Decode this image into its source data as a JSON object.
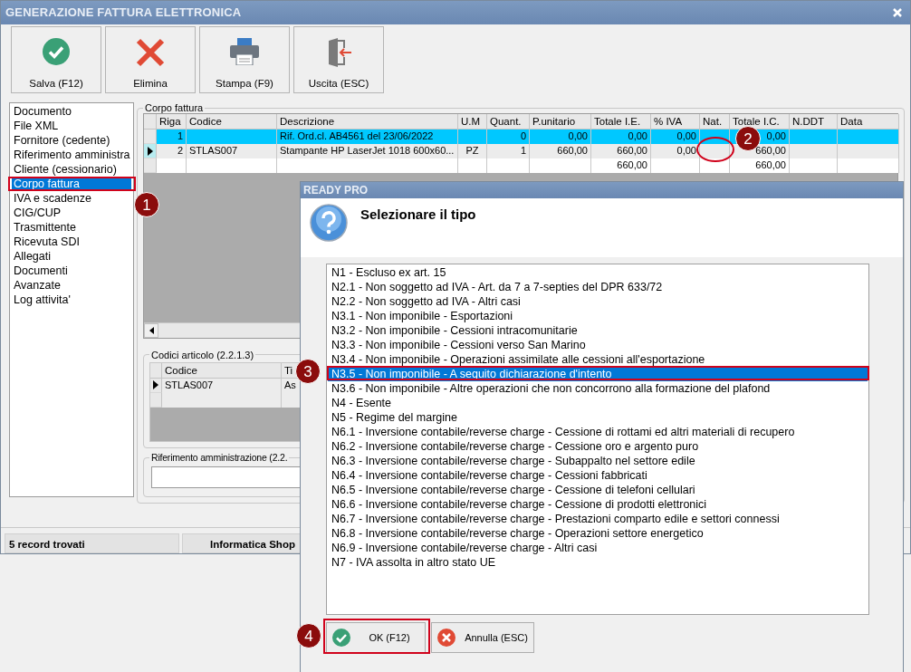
{
  "window": {
    "title": "GENERAZIONE FATTURA ELETTRONICA"
  },
  "toolbar": [
    {
      "label": "Salva (F12)",
      "kind": "save"
    },
    {
      "label": "Elimina",
      "kind": "delete"
    },
    {
      "label": "Stampa (F9)",
      "kind": "print"
    },
    {
      "label": "Uscita (ESC)",
      "kind": "exit"
    }
  ],
  "nav": {
    "items": [
      {
        "label": "Documento",
        "selected": false
      },
      {
        "label": "File XML",
        "selected": false
      },
      {
        "label": "Fornitore (cedente)",
        "selected": false
      },
      {
        "label": "Riferimento amministra",
        "selected": false
      },
      {
        "label": "Cliente (cessionario)",
        "selected": false
      },
      {
        "label": "Corpo fattura",
        "selected": true
      },
      {
        "label": "IVA e scadenze",
        "selected": false
      },
      {
        "label": "CIG/CUP",
        "selected": false
      },
      {
        "label": "Trasmittente",
        "selected": false
      },
      {
        "label": "Ricevuta SDI",
        "selected": false
      },
      {
        "label": "Allegati",
        "selected": false
      },
      {
        "label": "Documenti",
        "selected": false
      },
      {
        "label": "Avanzate",
        "selected": false
      },
      {
        "label": "Log attivita'",
        "selected": false
      }
    ]
  },
  "invoice_body": {
    "title": "Corpo fattura",
    "columns": [
      "Riga",
      "Codice",
      "Descrizione",
      "U.M",
      "Quant.",
      "P.unitario",
      "Totale I.E.",
      "% IVA",
      "Nat.",
      "Totale I.C.",
      "N.DDT",
      "Data"
    ],
    "rows": [
      {
        "selected": true,
        "current": false,
        "cells": [
          "1",
          null,
          "Rif. Ord.cl. AB4561 del 23/06/2022",
          null,
          "0",
          "0,00",
          "0,00",
          "0,00",
          null,
          "0,00",
          null,
          null
        ]
      },
      {
        "selected": false,
        "current": true,
        "cells": [
          "2",
          "STLAS007",
          "Stampante HP LaserJet 1018 600x60...",
          "PZ",
          "1",
          "660,00",
          "660,00",
          "0,00",
          null,
          "660,00",
          null,
          null
        ]
      },
      {
        "selected": false,
        "current": false,
        "cells": [
          null,
          null,
          null,
          null,
          null,
          null,
          "660,00",
          null,
          null,
          "660,00",
          null,
          null
        ]
      }
    ]
  },
  "article_codes": {
    "title": "Codici articolo (2.2.1.3)",
    "columns": [
      "Codice",
      "Ti"
    ],
    "rows": [
      {
        "current": true,
        "cells": [
          "STLAS007",
          "As"
        ]
      }
    ]
  },
  "admin_reference": {
    "title": "Riferimento amministrazione (2.2."
  },
  "status_bar": [
    "5 record trovati",
    "Informatica Shop"
  ],
  "dialog": {
    "title": "READY PRO",
    "message": "Selezionare il tipo",
    "options": [
      {
        "label": "N1 - Escluso ex art. 15",
        "selected": false
      },
      {
        "label": "N2.1 - Non soggetto ad IVA - Art. da 7 a 7-septies del DPR 633/72",
        "selected": false
      },
      {
        "label": "N2.2 - Non soggetto ad IVA - Altri casi",
        "selected": false
      },
      {
        "label": "N3.1 - Non imponibile - Esportazioni",
        "selected": false
      },
      {
        "label": "N3.2 - Non imponibile - Cessioni intracomunitarie",
        "selected": false
      },
      {
        "label": "N3.3 - Non imponibile - Cessioni verso San Marino",
        "selected": false
      },
      {
        "label": "N3.4 - Non imponibile - Operazioni assimilate alle cessioni all'esportazione",
        "selected": false
      },
      {
        "label": "N3.5 - Non imponibile - A seguito dichiarazione d'intento",
        "selected": true
      },
      {
        "label": "N3.6 - Non imponibile - Altre operazioni che non concorrono alla formazione del plafond",
        "selected": false
      },
      {
        "label": "N4 - Esente",
        "selected": false
      },
      {
        "label": "N5 - Regime del margine",
        "selected": false
      },
      {
        "label": "N6.1 - Inversione contabile/reverse charge - Cessione di rottami ed altri materiali di recupero",
        "selected": false
      },
      {
        "label": "N6.2 - Inversione contabile/reverse charge - Cessione oro e argento puro",
        "selected": false
      },
      {
        "label": "N6.3 - Inversione contabile/reverse charge - Subappalto nel settore edile",
        "selected": false
      },
      {
        "label": "N6.4 - Inversione contabile/reverse charge - Cessioni fabbricati",
        "selected": false
      },
      {
        "label": "N6.5 - Inversione contabile/reverse charge - Cessione di telefoni cellulari",
        "selected": false
      },
      {
        "label": "N6.6 - Inversione contabile/reverse charge - Cessione di prodotti elettronici",
        "selected": false
      },
      {
        "label": "N6.7 - Inversione contabile/reverse charge - Prestazioni comparto edile e settori connessi",
        "selected": false
      },
      {
        "label": "N6.8 - Inversione contabile/reverse charge - Operazioni settore energetico",
        "selected": false
      },
      {
        "label": "N6.9 - Inversione contabile/reverse charge - Altri casi",
        "selected": false
      },
      {
        "label": "N7 - IVA assolta in altro stato UE",
        "selected": false
      }
    ],
    "buttons": [
      {
        "label": "OK (F12)",
        "kind": "ok"
      },
      {
        "label": "Annulla (ESC)",
        "kind": "cancel"
      }
    ]
  },
  "annotations": [
    "1",
    "2",
    "3",
    "4"
  ]
}
